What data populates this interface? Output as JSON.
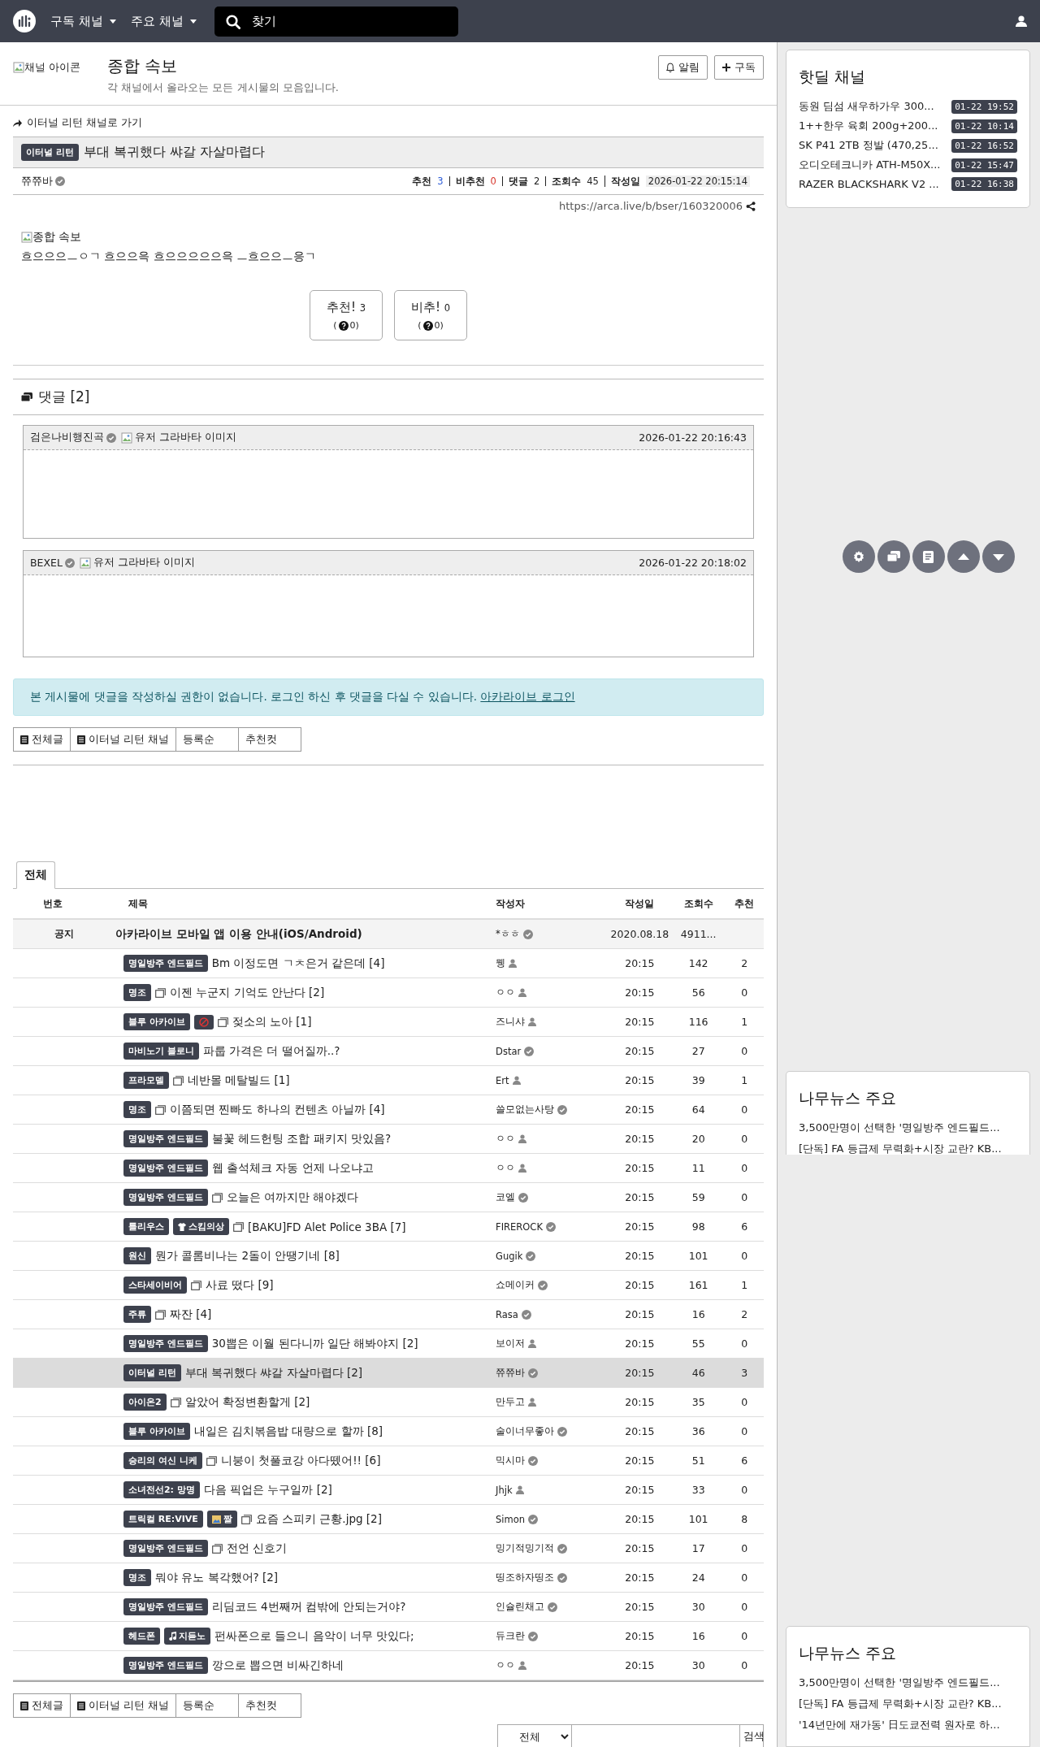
{
  "header": {
    "menus": [
      "구독 채널",
      "주요 채널"
    ],
    "search": {
      "placeholder": "찾기"
    }
  },
  "channel": {
    "icon_alt": "채널 아이콘",
    "title": "종합 속보",
    "description": "각 채널에서 올라오는 모든 게시물의 모음입니다.",
    "buttons": [
      {
        "kind": "bell",
        "label": "알림"
      },
      {
        "kind": "plus",
        "label": "구독"
      }
    ]
  },
  "post": {
    "back_link": "이터널 리턴 채널로 가기",
    "category": "이터널 리턴",
    "title": "부대 복귀했다 쌰갈 자살마렵다",
    "author": "쮸쮸바",
    "meta": [
      {
        "label": "추천",
        "value": "3",
        "color": "#2b5bd7"
      },
      {
        "label": "비추천",
        "value": "0",
        "color": "#d7352b"
      },
      {
        "label": "댓글",
        "value": "2",
        "color": "#222222"
      },
      {
        "label": "조회수",
        "value": "45",
        "color": "#222222"
      },
      {
        "label": "작성일",
        "value": "2026-01-22 20:15:14",
        "color": "#222222"
      }
    ],
    "url": "https://arca.live/b/bser/160320006",
    "image_alt": "종합 속보",
    "body": "흐으으으ㅡㅇㄱ 흐으으윽 흐으으으으으윽 ㅡ흐으으ㅡ응ㄱ",
    "votes": [
      {
        "label": "추천!",
        "count": "3",
        "sub_before": "(",
        "sub_after": "0)"
      },
      {
        "label": "비추!",
        "count": "0",
        "sub_before": "(",
        "sub_after": "0)"
      }
    ]
  },
  "comments": {
    "title": "댓글 [2]",
    "items": [
      {
        "author": "검은나비행진곡",
        "avatar_alt": "유저 그라바타 이미지",
        "date": "2026-01-22 20:16:43"
      },
      {
        "author": "BEXEL",
        "avatar_alt": "유저 그라바타 이미지",
        "date": "2026-01-22 20:18:02"
      }
    ]
  },
  "notice": {
    "text": "본 게시물에 댓글을 작성하실 권한이 없습니다. 로그인 하신 후 댓글을 다실 수 있습니다.",
    "link": "아카라이브 로그인"
  },
  "board_buttons_top": [
    {
      "kind": "board",
      "label": "전체글"
    },
    {
      "kind": "board",
      "label": "이터널 리턴 채널"
    },
    {
      "kind": "sort",
      "label": "등록순"
    },
    {
      "kind": "sort",
      "label": "추천컷"
    }
  ],
  "tabs": [
    {
      "label": "전체",
      "selected": true
    }
  ],
  "table": {
    "columns": [
      "번호",
      "제목",
      "작성자",
      "작성일",
      "조회수",
      "추천"
    ],
    "rows": [
      {
        "kind": "notice",
        "number": "공지",
        "badges": [],
        "has_image": false,
        "title": "아카라이브 모바일 앱 이용 안내(iOS/Android)",
        "author": "*ㅎㅎ",
        "verified": true,
        "date": "2020.08.18",
        "views": "4911...",
        "selected": false
      },
      {
        "kind": "post",
        "badges": [
          {
            "kind": "text",
            "text": "명일방주 엔드필드"
          }
        ],
        "has_image": false,
        "title": "Bm 이정도면 ㄱㅊ은거 같은데 [4]",
        "author": "뮁",
        "verified": false,
        "date": "20:15",
        "views": "142",
        "likes": "2",
        "selected": false
      },
      {
        "kind": "post",
        "badges": [
          {
            "kind": "text",
            "text": "명조"
          }
        ],
        "has_image": true,
        "title": "이젠 누군지 기억도 안난다 [2]",
        "author": "ㅇㅇ",
        "verified": false,
        "date": "20:15",
        "views": "56",
        "likes": "0",
        "selected": false
      },
      {
        "kind": "post",
        "badges": [
          {
            "kind": "text",
            "text": "블루 아카이브"
          },
          {
            "kind": "adult"
          }
        ],
        "has_image": true,
        "title": "젖소의 노아 [1]",
        "author": "즈니샤",
        "verified": false,
        "date": "20:15",
        "views": "116",
        "likes": "1",
        "selected": false
      },
      {
        "kind": "post",
        "badges": [
          {
            "kind": "text",
            "text": "마비노기 블로니"
          }
        ],
        "has_image": false,
        "title": "파룹 가격은 더 떨어질까..?",
        "author": "Dstar",
        "verified": true,
        "date": "20:15",
        "views": "27",
        "likes": "0",
        "selected": false
      },
      {
        "kind": "post",
        "badges": [
          {
            "kind": "text",
            "text": "프라모델"
          }
        ],
        "has_image": true,
        "title": "네반몰 메탈빌드 [1]",
        "author": "Ert",
        "verified": false,
        "date": "20:15",
        "views": "39",
        "likes": "1",
        "selected": false
      },
      {
        "kind": "post",
        "badges": [
          {
            "kind": "text",
            "text": "명조"
          }
        ],
        "has_image": true,
        "title": "이쯤되면 찐빠도 하나의 컨텐츠 아닐까 [4]",
        "author": "쓸모없는사탕",
        "verified": true,
        "date": "20:15",
        "views": "64",
        "likes": "0",
        "selected": false
      },
      {
        "kind": "post",
        "badges": [
          {
            "kind": "text",
            "text": "명일방주 엔드필드"
          }
        ],
        "has_image": false,
        "title": "불꽃 헤드헌팅 조합 패키지 맛있음?",
        "author": "ㅇㅇ",
        "verified": false,
        "date": "20:15",
        "views": "20",
        "likes": "0",
        "selected": false
      },
      {
        "kind": "post",
        "badges": [
          {
            "kind": "text",
            "text": "명일방주 엔드필드"
          }
        ],
        "has_image": false,
        "title": "웹 출석체크 자동 언제 나오냐고",
        "author": "ㅇㅇ",
        "verified": false,
        "date": "20:15",
        "views": "11",
        "likes": "0",
        "selected": false
      },
      {
        "kind": "post",
        "badges": [
          {
            "kind": "text",
            "text": "명일방주 엔드필드"
          }
        ],
        "has_image": true,
        "title": "오늘은 여까지만 해야겠다",
        "author": "코엘",
        "verified": true,
        "date": "20:15",
        "views": "59",
        "likes": "0",
        "selected": false
      },
      {
        "kind": "post",
        "badges": [
          {
            "kind": "text",
            "text": "틀리우스"
          },
          {
            "kind": "shirt",
            "text": "스킴의상"
          }
        ],
        "has_image": true,
        "title": "[BAKU]FD Alet Police 3BA [7]",
        "author": "FIREROCK",
        "verified": true,
        "date": "20:15",
        "views": "98",
        "likes": "6",
        "selected": false
      },
      {
        "kind": "post",
        "badges": [
          {
            "kind": "text",
            "text": "원신"
          }
        ],
        "has_image": false,
        "title": "뭔가 콜롬비나는 2돌이 안땡기네 [8]",
        "author": "Gugik",
        "verified": true,
        "date": "20:15",
        "views": "101",
        "likes": "0",
        "selected": false
      },
      {
        "kind": "post",
        "badges": [
          {
            "kind": "text",
            "text": "스타세이비어"
          }
        ],
        "has_image": true,
        "title": "사료 떴다 [9]",
        "author": "쇼메이커",
        "verified": true,
        "date": "20:15",
        "views": "161",
        "likes": "1",
        "selected": false
      },
      {
        "kind": "post",
        "badges": [
          {
            "kind": "text",
            "text": "주류"
          }
        ],
        "has_image": true,
        "title": "짜잔 [4]",
        "author": "Rasa",
        "verified": true,
        "date": "20:15",
        "views": "16",
        "likes": "2",
        "selected": false
      },
      {
        "kind": "post",
        "badges": [
          {
            "kind": "text",
            "text": "명일방주 엔드필드"
          }
        ],
        "has_image": false,
        "title": "30뽑은 이월 된다니까 일단 해봐야지 [2]",
        "author": "보이저",
        "verified": false,
        "date": "20:15",
        "views": "55",
        "likes": "0",
        "selected": false
      },
      {
        "kind": "post",
        "badges": [
          {
            "kind": "text",
            "text": "이터널 리턴"
          }
        ],
        "has_image": false,
        "title": "부대 복귀했다 쌰갈 자살마렵다 [2]",
        "author": "쮸쮸바",
        "verified": true,
        "date": "20:15",
        "views": "46",
        "likes": "3",
        "selected": true
      },
      {
        "kind": "post",
        "badges": [
          {
            "kind": "text",
            "text": "아이온2"
          }
        ],
        "has_image": true,
        "title": "알았어 확정변환할게 [2]",
        "author": "만두고",
        "verified": false,
        "date": "20:15",
        "views": "35",
        "likes": "0",
        "selected": false
      },
      {
        "kind": "post",
        "badges": [
          {
            "kind": "text",
            "text": "블루 아카이브"
          }
        ],
        "has_image": false,
        "title": "내일은 김치볶음밥 대량으로 할까 [8]",
        "author": "술이너무좋아",
        "verified": true,
        "date": "20:15",
        "views": "36",
        "likes": "0",
        "selected": false
      },
      {
        "kind": "post",
        "badges": [
          {
            "kind": "text",
            "text": "승리의 여신 니케"
          }
        ],
        "has_image": true,
        "title": "니붕이 첫풀코강 아다뗐어!! [6]",
        "author": "믹시마",
        "verified": true,
        "date": "20:15",
        "views": "51",
        "likes": "6",
        "selected": false
      },
      {
        "kind": "post",
        "badges": [
          {
            "kind": "text",
            "text": "소녀전선2: 망명"
          }
        ],
        "has_image": false,
        "title": "다음 픽업은 누구일까 [2]",
        "author": "Jhjk",
        "verified": false,
        "date": "20:15",
        "views": "33",
        "likes": "0",
        "selected": false
      },
      {
        "kind": "post",
        "badges": [
          {
            "kind": "text",
            "text": "트릭컬 RE:VIVE"
          },
          {
            "kind": "picture",
            "text": "짤"
          }
        ],
        "has_image": true,
        "title": "요즘 스피키 근황.jpg [2]",
        "author": "Simon",
        "verified": true,
        "date": "20:15",
        "views": "101",
        "likes": "8",
        "selected": false
      },
      {
        "kind": "post",
        "badges": [
          {
            "kind": "text",
            "text": "명일방주 엔드필드"
          }
        ],
        "has_image": true,
        "title": "전언 신호기",
        "author": "밍기적밍기적",
        "verified": true,
        "date": "20:15",
        "views": "17",
        "likes": "0",
        "selected": false
      },
      {
        "kind": "post",
        "badges": [
          {
            "kind": "text",
            "text": "명조"
          }
        ],
        "has_image": false,
        "title": "뭐야 유노 복각했어? [2]",
        "author": "띵조하자띵조",
        "verified": true,
        "date": "20:15",
        "views": "24",
        "likes": "0",
        "selected": false
      },
      {
        "kind": "post",
        "badges": [
          {
            "kind": "text",
            "text": "명일방주 엔드필드"
          }
        ],
        "has_image": false,
        "title": "리딤코드 4번째꺼 컴밖에 안되는거야?",
        "author": "인슐린채고",
        "verified": true,
        "date": "20:15",
        "views": "30",
        "likes": "0",
        "selected": false
      },
      {
        "kind": "post",
        "badges": [
          {
            "kind": "text",
            "text": "헤드폰"
          },
          {
            "kind": "music",
            "text": "지듣노"
          }
        ],
        "has_image": false,
        "title": "펀싸폰으로 들으니 음악이 너무 맛있다;",
        "author": "듀크란",
        "verified": true,
        "date": "20:15",
        "views": "16",
        "likes": "0",
        "selected": false
      },
      {
        "kind": "post",
        "badges": [
          {
            "kind": "text",
            "text": "명일방주 엔드필드"
          }
        ],
        "has_image": false,
        "title": "깡으로 뽑으면 비싸긴하네",
        "author": "ㅇㅇ",
        "verified": false,
        "date": "20:15",
        "views": "30",
        "likes": "0",
        "selected": false
      }
    ]
  },
  "board_buttons_bottom": [
    {
      "kind": "board",
      "label": "전체글"
    },
    {
      "kind": "board",
      "label": "이터널 리턴 채널"
    },
    {
      "kind": "sort",
      "label": "등록순"
    },
    {
      "kind": "sort",
      "label": "추천컷"
    }
  ],
  "search_form": {
    "scope": "전체",
    "button": "검색"
  },
  "sidebar": {
    "hotdeal": {
      "title": "핫딜 채널",
      "items": [
        {
          "title": "동원 딤섬 새우하가우 300...",
          "time": "01-22 19:52"
        },
        {
          "title": "1++한우 육회 200g+200...",
          "time": "01-22 10:14"
        },
        {
          "title": "SK P41 2TB 정발 (470,25...",
          "time": "01-22 16:52"
        },
        {
          "title": "오디오테크니카 ATH-M50X...",
          "time": "01-22 15:47"
        },
        {
          "title": "RAZER BLACKSHARK V2 ...",
          "time": "01-22 16:38"
        }
      ]
    },
    "news_cards": [
      {
        "title": "나무뉴스 주요",
        "items": [
          "3,500만명이 선택한 '명일방주 엔드필드...",
          "[단독] FA 등급제 무력화+시장 교란? KB..."
        ]
      },
      {
        "title": "나무뉴스 주요",
        "items": [
          "3,500만명이 선택한 '명일방주 엔드필드...",
          "[단독] FA 등급제 무력화+시장 교란? KB...",
          "'14년만에 재가동' 日도쿄전력 원자로 하..."
        ]
      }
    ]
  }
}
